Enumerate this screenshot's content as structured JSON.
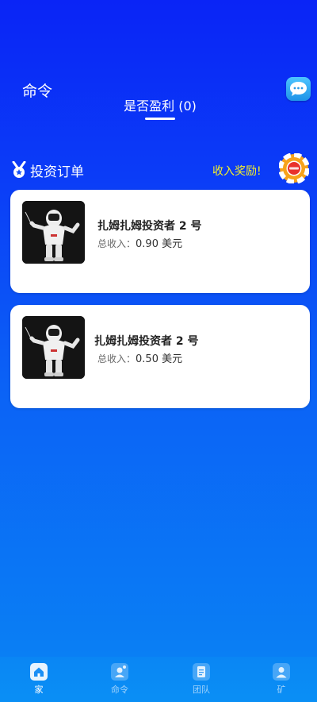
{
  "header": {
    "title": "命令",
    "tab_label": "是否盈利 (0)",
    "chat_icon": "chat-bubble-icon"
  },
  "section": {
    "title": "投资订单",
    "reward_link": "收入奖励!",
    "reward_icon": "lifebuoy-icon"
  },
  "orders": [
    {
      "name": "扎姆扎姆投资者 2 号",
      "income_label": "总收入：",
      "income_value": "0.90 美元"
    },
    {
      "name": "扎姆扎姆投资者 2 号",
      "income_label": "总收入：",
      "income_value": "0.50 美元"
    }
  ],
  "nav": {
    "items": [
      {
        "label": "家",
        "icon": "home-icon",
        "active": true
      },
      {
        "label": "命令",
        "icon": "orders-icon",
        "active": false
      },
      {
        "label": "团队",
        "icon": "team-icon",
        "active": false
      },
      {
        "label": "矿",
        "icon": "mine-icon",
        "active": false
      }
    ]
  },
  "colors": {
    "accent_yellow": "#f4ef2a",
    "background_top": "#0a24f6",
    "background_bottom": "#0a84f4"
  }
}
